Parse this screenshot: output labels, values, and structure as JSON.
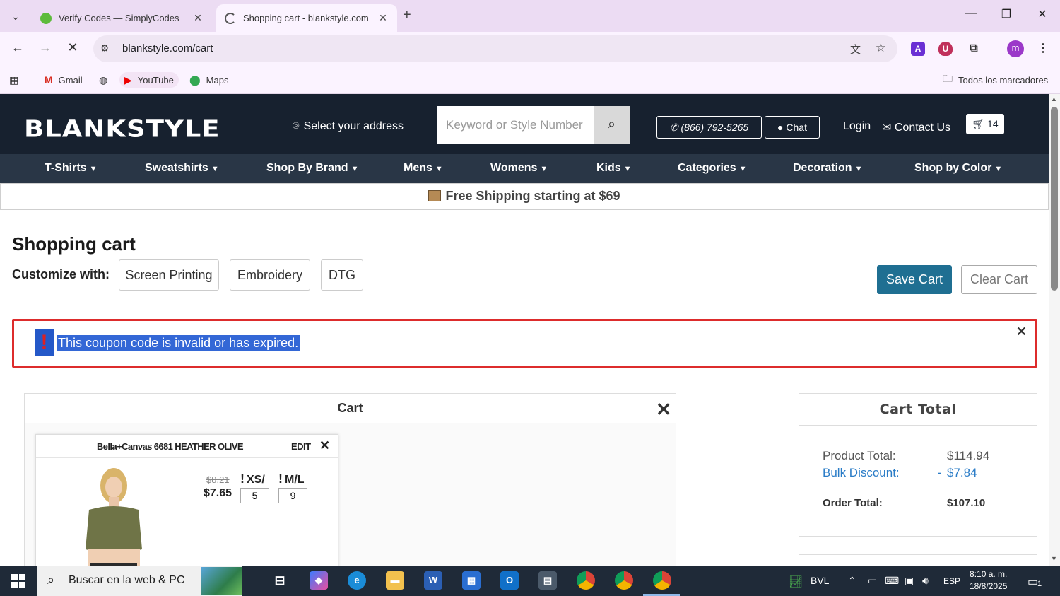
{
  "browser": {
    "tabs": [
      {
        "title": "Verify Codes — SimplyCodes",
        "active": false
      },
      {
        "title": "Shopping cart - blankstyle.com",
        "active": true
      }
    ],
    "url": "blankstyle.com/cart",
    "bookmarks": [
      "Gmail",
      "YouTube",
      "Maps"
    ],
    "all_bookmarks": "Todos los marcadores",
    "profile_initial": "m"
  },
  "header": {
    "logo": "BLANKSTYLE",
    "address": "Select your address",
    "search_placeholder": "Keyword or Style Number",
    "phone": "(866) 792-5265",
    "chat": "Chat",
    "login": "Login",
    "contact": "Contact Us",
    "cart_count": "14"
  },
  "nav": [
    "T-Shirts",
    "Sweatshirts",
    "Shop By Brand",
    "Mens",
    "Womens",
    "Kids",
    "Categories",
    "Decoration",
    "Shop by Color"
  ],
  "shipping_banner": "Free Shipping starting at $69",
  "page": {
    "title": "Shopping cart",
    "customize_label": "Customize with:",
    "customize_options": [
      "Screen Printing",
      "Embroidery",
      "DTG"
    ],
    "save_cart": "Save Cart",
    "clear_cart": "Clear Cart"
  },
  "alert": {
    "icon": "!",
    "message": "This coupon code is invalid or has expired."
  },
  "cart": {
    "heading": "Cart",
    "item": {
      "name": "Bella+Canvas 6681 HEATHER OLIVE",
      "edit": "EDIT",
      "old_price": "$8.21",
      "price": "$7.65",
      "sizes": [
        {
          "label": "XS/",
          "qty": "5"
        },
        {
          "label": "M/L",
          "qty": "9"
        }
      ]
    }
  },
  "totals": {
    "heading": "Cart Total",
    "product_total_label": "Product Total:",
    "product_total": "$114.94",
    "bulk_discount_label": "Bulk Discount:",
    "bulk_discount_sign": "-",
    "bulk_discount": "$7.84",
    "order_total_label": "Order Total:",
    "order_total": "$107.10"
  },
  "taskbar": {
    "search_text": "Buscar en la web & PC",
    "weather": "BVL",
    "language": "ESP",
    "time": "8:10 a. m.",
    "date": "18/8/2025",
    "notifications": "1"
  },
  "colors": {
    "header_bg": "#17212f",
    "nav_bg": "#293646",
    "save_button": "#1f6f92",
    "alert_border": "#dd2c2c",
    "discount_text": "#2a7cc7"
  }
}
